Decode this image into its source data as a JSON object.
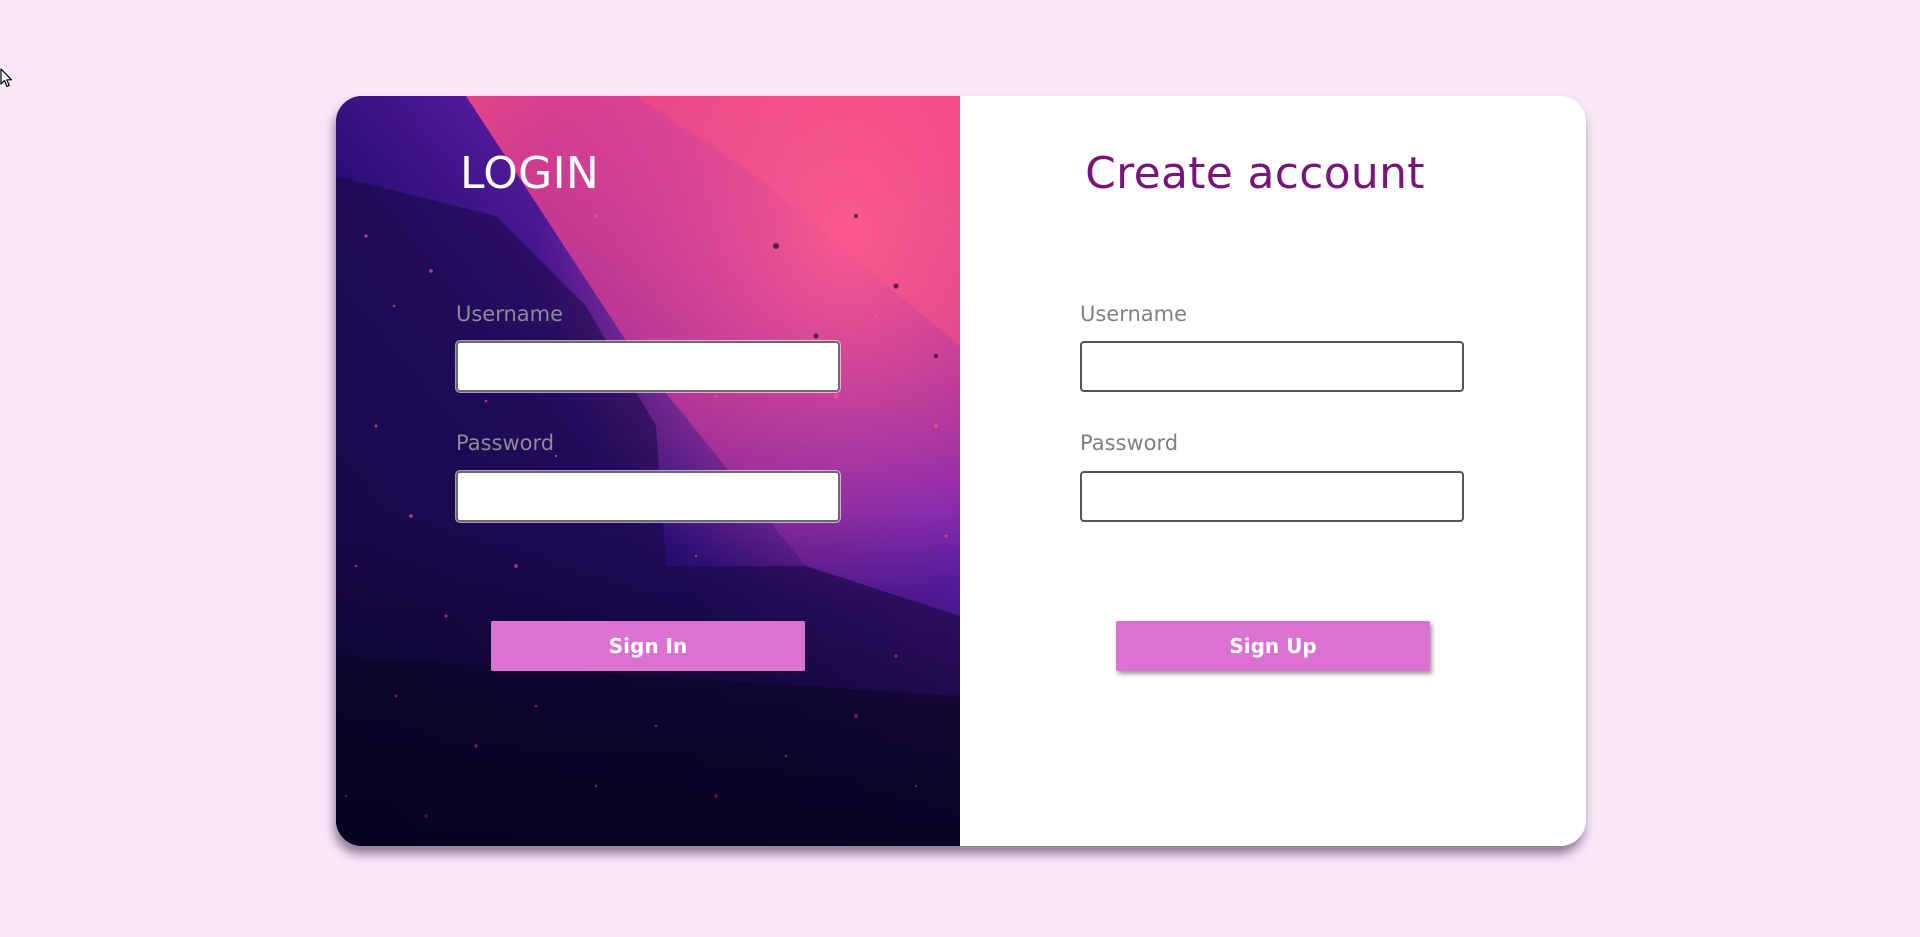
{
  "login": {
    "title": "LOGIN",
    "username_label": "Username",
    "username_value": "",
    "password_label": "Password",
    "password_value": "",
    "submit_label": "Sign In"
  },
  "signup": {
    "title": "Create account",
    "username_label": "Username",
    "username_value": "",
    "password_label": "Password",
    "password_value": "",
    "submit_label": "Sign Up"
  },
  "colors": {
    "page_background": "#f8e6f9",
    "accent_button": "#da72cf",
    "signup_title": "#78157a",
    "label_text": "#808080"
  },
  "icons": {
    "cursor": "mouse-pointer-icon"
  }
}
